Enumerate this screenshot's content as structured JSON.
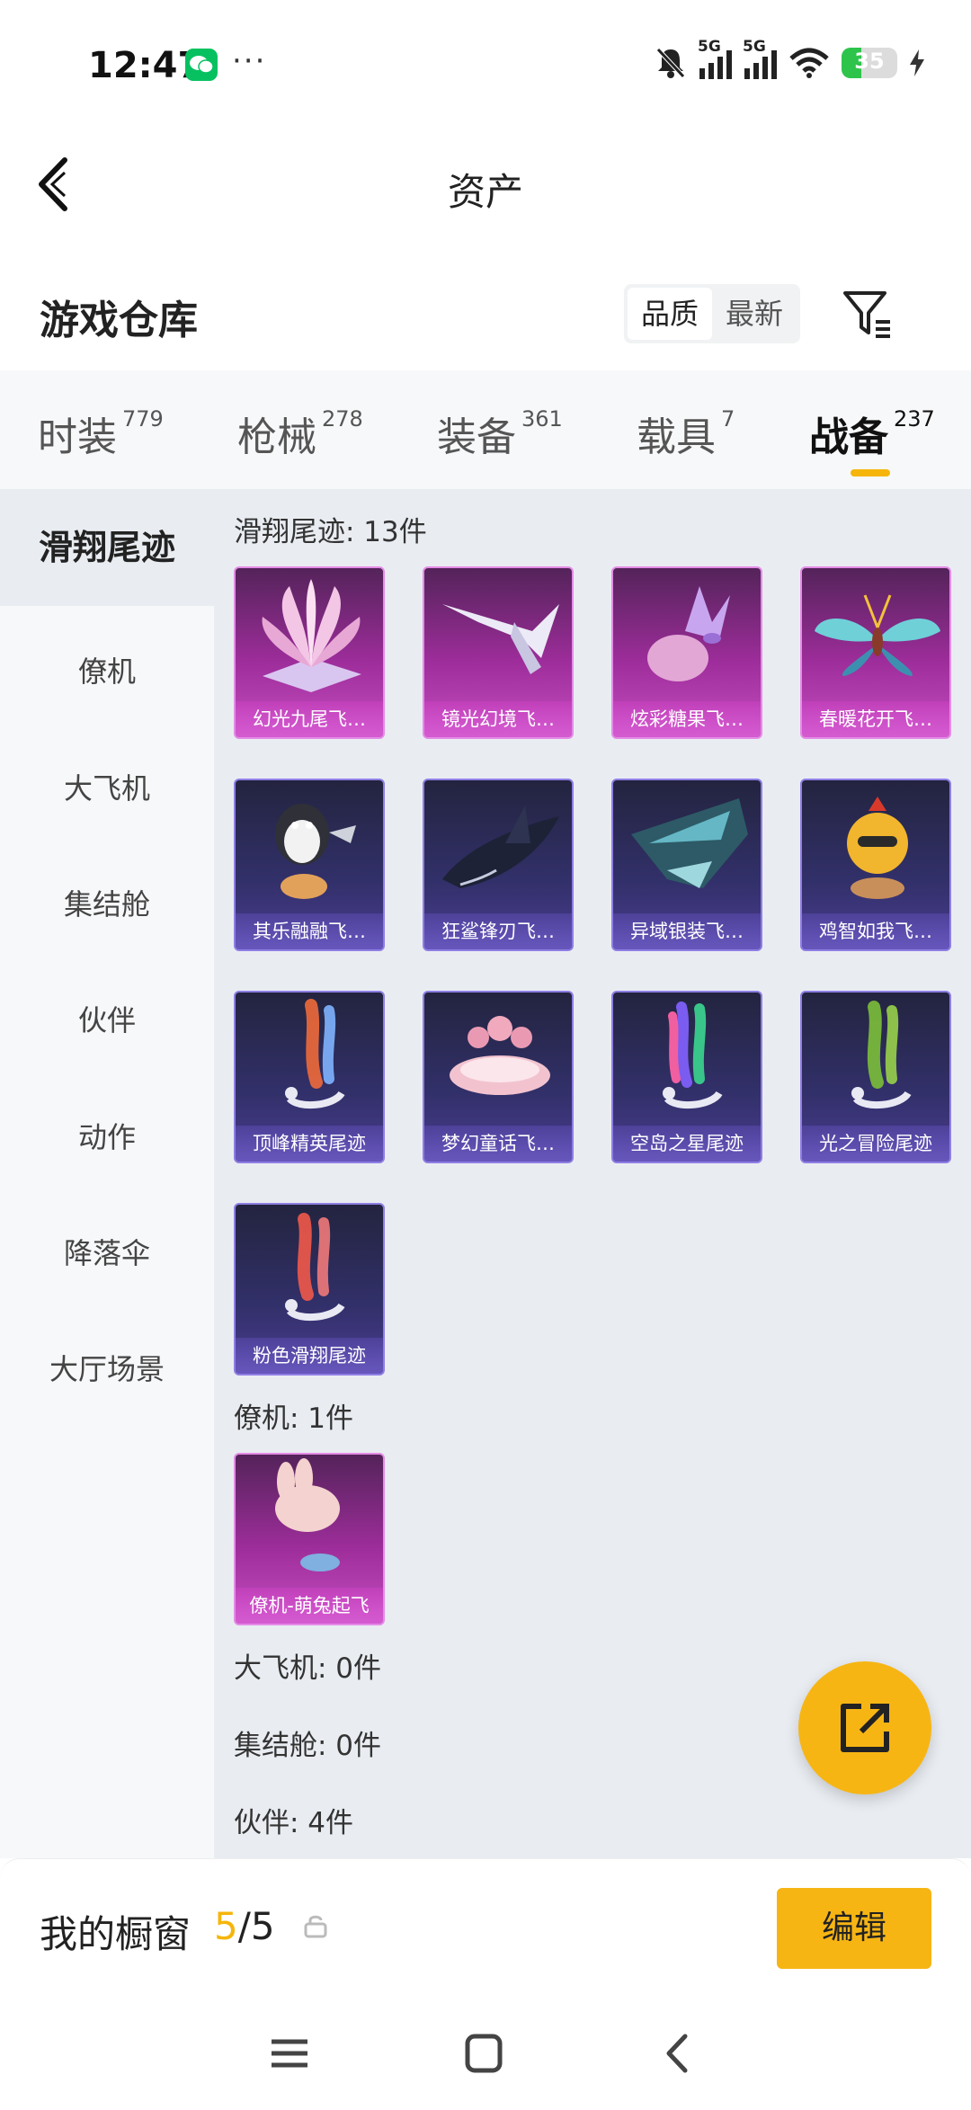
{
  "status_bar": {
    "time": "12:47",
    "dots": "···",
    "network1": "5G",
    "network2": "5G",
    "battery": "35"
  },
  "header": {
    "title": "资产",
    "back_icon": "back-arrow-icon"
  },
  "warehouse": {
    "title": "游戏仓库",
    "sort_options": [
      "品质",
      "最新"
    ],
    "sort_selected": "品质",
    "filter_icon": "filter-icon"
  },
  "tabs": [
    {
      "label": "时装",
      "count": "779"
    },
    {
      "label": "枪械",
      "count": "278"
    },
    {
      "label": "装备",
      "count": "361"
    },
    {
      "label": "载具",
      "count": "7"
    },
    {
      "label": "战备",
      "count": "237",
      "active": true
    }
  ],
  "categories": [
    "滑翔尾迹",
    "僚机",
    "大飞机",
    "集结舱",
    "伙伴",
    "动作",
    "降落伞",
    "大厅场景"
  ],
  "sections": {
    "glide": {
      "heading": "滑翔尾迹: 13件",
      "items": [
        "幻光九尾飞…",
        "镜光幻境飞…",
        "炫彩糖果飞…",
        "春暖花开飞…",
        "其乐融融飞…",
        "狂鲨锋刃飞…",
        "异域银装飞…",
        "鸡智如我飞…",
        "顶峰精英尾迹",
        "梦幻童话飞…",
        "空岛之星尾迹",
        "光之冒险尾迹",
        "粉色滑翔尾迹"
      ]
    },
    "wingman": {
      "heading": "僚机: 1件",
      "items": [
        "僚机-萌兔起飞"
      ]
    },
    "big_plane": {
      "heading": "大飞机: 0件"
    },
    "capsule": {
      "heading": "集结舱: 0件"
    },
    "partner": {
      "heading": "伙伴: 4件"
    }
  },
  "fab": {
    "icon": "share-external-icon"
  },
  "showcase": {
    "label": "我的橱窗",
    "current": "5",
    "total": "/5",
    "edit_label": "编辑"
  },
  "navbar": {
    "icons": [
      "menu-icon",
      "home-icon",
      "back-icon"
    ]
  },
  "colors": {
    "accent": "#f7b514",
    "rare_pink": "#c64ec0",
    "rare_purple": "#4b3d92"
  }
}
